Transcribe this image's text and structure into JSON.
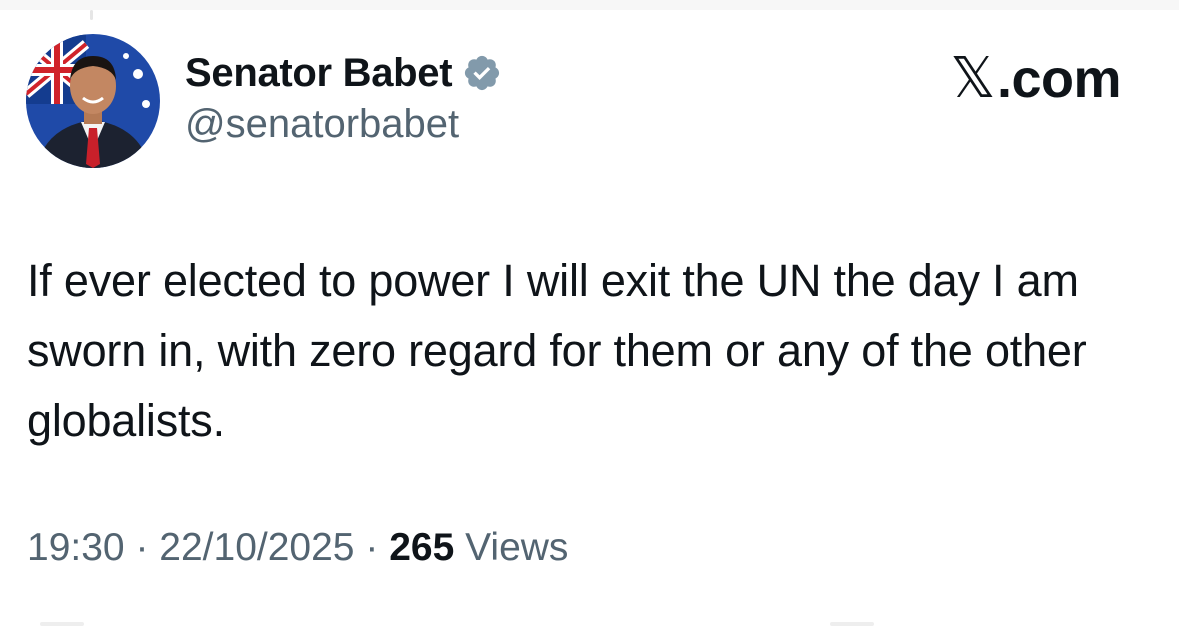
{
  "author": {
    "display_name": "Senator Babet",
    "handle": "@senatorbabet",
    "verified": true,
    "badge_color": "#829aab"
  },
  "brand": {
    "x_glyph": "𝕏",
    "suffix": ".com"
  },
  "tweet": {
    "text": "If ever elected to power I will exit the UN the day I am sworn in, with zero regard for them or any of the other globalists."
  },
  "meta": {
    "time": "19:30",
    "separator": "·",
    "date": "22/10/2025",
    "views_count": "265",
    "views_label": "Views"
  },
  "colors": {
    "text_primary": "#0f1419",
    "text_secondary": "#536471"
  }
}
